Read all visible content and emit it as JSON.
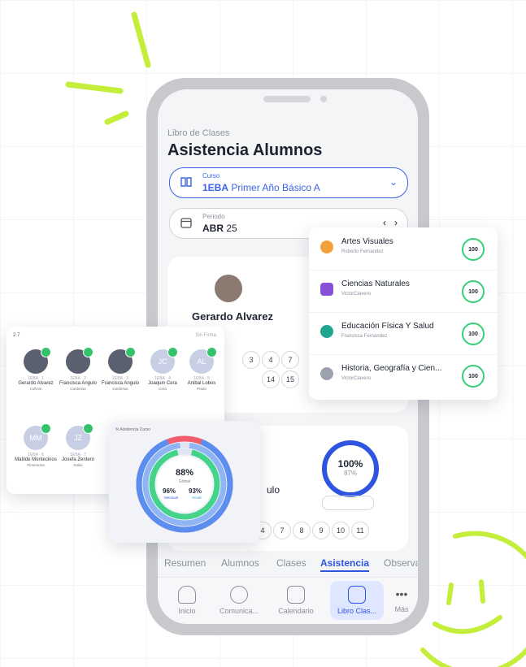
{
  "header": {
    "breadcrumb": "Libro de Clases",
    "title": "Asistencia Alumnos"
  },
  "course_selector": {
    "label": "Curso",
    "code": "1EBA",
    "value": "Primer Año Básico A"
  },
  "period_selector": {
    "label": "Periodo",
    "month": "ABR",
    "year": "25"
  },
  "student_card": {
    "name": "Gerardo Alvarez",
    "days_row1": [
      "3",
      "4",
      "7"
    ],
    "days_row2": [
      "14",
      "15"
    ]
  },
  "second_card": {
    "subject_partial": "ulo",
    "percent": "100%",
    "percent_sub": "87%",
    "days": [
      "4",
      "7",
      "8",
      "9",
      "10",
      "11"
    ]
  },
  "tabs": [
    "Resumen",
    "Alumnos",
    "Clases",
    "Asistencia",
    "Observa"
  ],
  "active_tab": "Asistencia",
  "bottom_nav": [
    "Inicio",
    "Comunica...",
    "Calendario",
    "Libro Clas...",
    "Más"
  ],
  "subjects": [
    {
      "name": "Artes Visuales",
      "teacher": "Roberto Fernandez",
      "score": "100",
      "icon": "palette-icon",
      "color": "#f2a23a"
    },
    {
      "name": "Ciencias Naturales",
      "teacher": "VictorClavero",
      "score": "100",
      "icon": "flask-icon",
      "color": "#8a4fd8"
    },
    {
      "name": "Educación Física Y Salud",
      "teacher": "Francisca Fernandez",
      "score": "100",
      "icon": "ball-icon",
      "color": "#1fa68f"
    },
    {
      "name": "Historia, Geografía y Cien...",
      "teacher": "VictorClavero",
      "score": "100",
      "icon": "globe-icon",
      "color": "#6b7280"
    }
  ],
  "students_panel": {
    "header_left": "2 7",
    "header_right": "Sin Firma",
    "students": [
      {
        "code": "1EBA · 1",
        "name": "Gerardo Alvarez",
        "sub": "Cofrom",
        "initials": ""
      },
      {
        "code": "1EBA · 2",
        "name": "Francisca Angulo",
        "sub": "Cardenas",
        "initials": ""
      },
      {
        "code": "1EBA · 3",
        "name": "Francisca Angulo",
        "sub": "Cardenas",
        "initials": ""
      },
      {
        "code": "1EBA · 4",
        "name": "Joaquin Cera",
        "sub": "Cera",
        "initials": "JC"
      },
      {
        "code": "1EBA · 5",
        "name": "Anibal Lobos",
        "sub": "Prado",
        "initials": "AL"
      },
      {
        "code": "1EBA · 6",
        "name": "Matilde Montecinos",
        "sub": "Pimentona",
        "initials": "MM"
      },
      {
        "code": "1EBA · 7",
        "name": "Josefa Zentero",
        "sub": "Salas",
        "initials": "JZ"
      }
    ]
  },
  "attendance_chart": {
    "title": "% Asistencia Curso",
    "center_value": "88%",
    "center_label": "Global",
    "left_value": "96%",
    "left_label": "Mensual",
    "right_value": "93%",
    "right_label": "Anual",
    "chart_data": {
      "type": "pie",
      "series": [
        {
          "values": [
            88,
            12
          ]
        },
        {
          "values": [
            96,
            4
          ]
        },
        {
          "values": [
            93,
            7
          ]
        }
      ]
    }
  },
  "colors": {
    "accent": "#3b63e6",
    "green": "#37d07a",
    "deco_green": "#c3ee3a",
    "red": "#f25c6b"
  }
}
